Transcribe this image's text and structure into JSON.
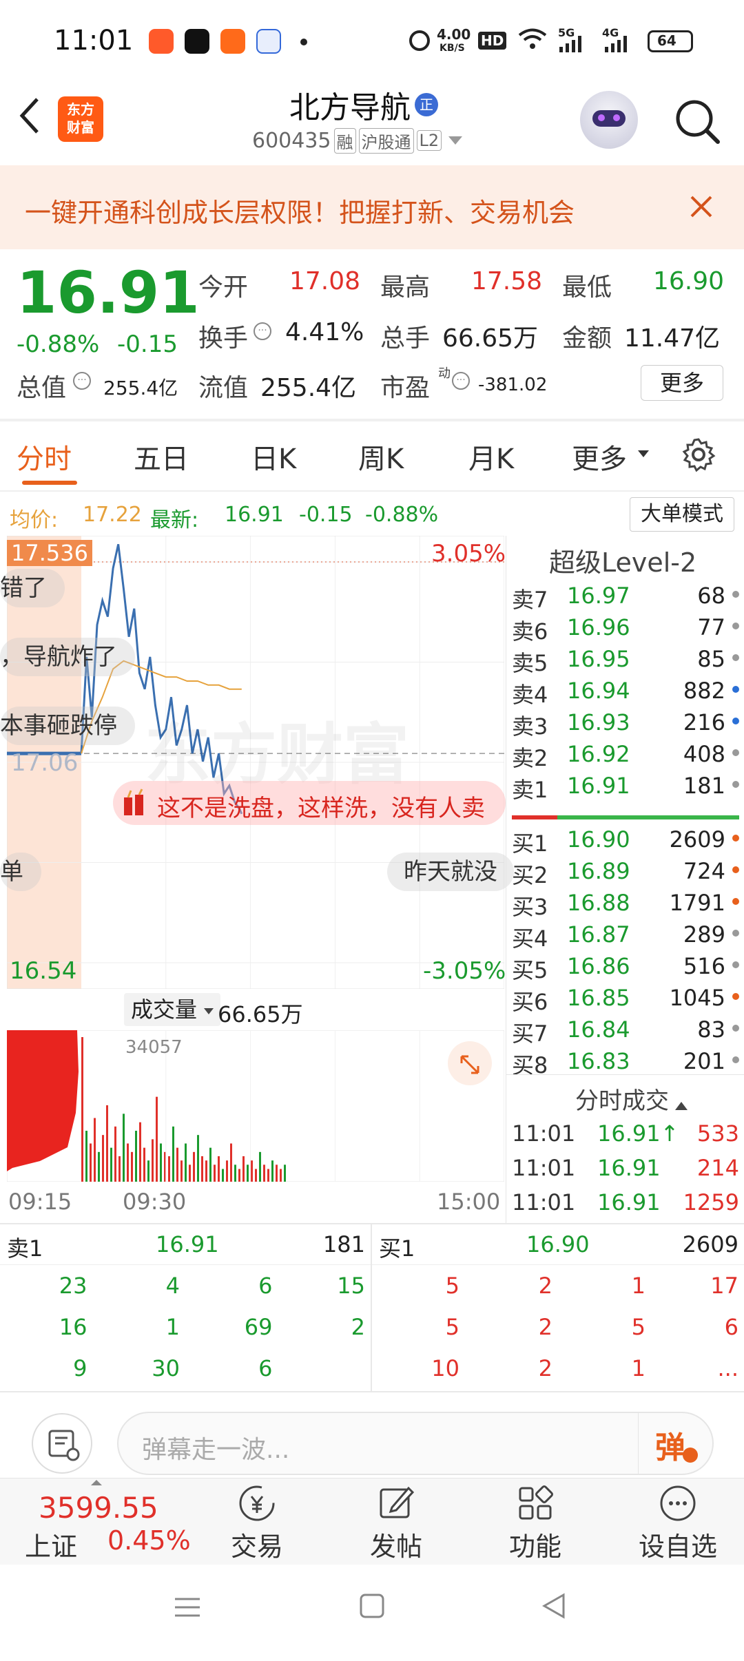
{
  "status_bar": {
    "time": "11:01",
    "net_speed_top": "4.00",
    "net_speed_unit": "KB/S",
    "hd_label": "HD",
    "net_5g": "5G",
    "net_4g": "4G",
    "battery": "64"
  },
  "header": {
    "back_label": "‹",
    "app_logo_line1": "东方",
    "app_logo_line2": "财富",
    "stock_name": "北方导航",
    "zheng_badge": "正",
    "stock_code": "600435",
    "tag_rong": "融",
    "tag_hugutong": "沪股通",
    "tag_l2": "L2"
  },
  "banner": {
    "text": "一键开通科创成长层权限！把握打新、交易机会"
  },
  "quote": {
    "price": "16.91",
    "change_pct": "-0.88%",
    "change": "-0.15",
    "open_label": "今开",
    "open": "17.08",
    "high_label": "最高",
    "high": "17.58",
    "low_label": "最低",
    "low": "16.90",
    "turnover_label": "换手",
    "turnover": "4.41%",
    "volume_label": "总手",
    "volume": "66.65万",
    "amount_label": "金额",
    "amount": "11.47亿",
    "mktcap_label": "总值",
    "mktcap": "255.4亿",
    "float_label": "流值",
    "float_cap": "255.4亿",
    "pe_label": "市盈",
    "pe_sup": "动",
    "pe": "-381.02",
    "more_button": "更多"
  },
  "tabs": [
    "分时",
    "五日",
    "日K",
    "周K",
    "月K",
    "更多"
  ],
  "avg_line": {
    "avg_label": "均价:",
    "avg": "17.22",
    "latest_label": "最新:",
    "latest": "16.91",
    "chg": "-0.15",
    "chg_pct": "-0.88%",
    "big_order_button": "大单模式"
  },
  "chart": {
    "top_price": "17.536",
    "top_pct": "3.05%",
    "bottom_price": "16.54",
    "bottom_pct": "-3.05%",
    "prev_close_partial": "17.06",
    "watermark": "东方财富",
    "danmu": [
      "错了",
      "，导航炸了",
      "本事砸跌停",
      "这不是洗盘，这样洗，没有人卖",
      "单",
      "昨天就没"
    ]
  },
  "chart_data": {
    "type": "line",
    "title": "",
    "series": [
      {
        "name": "最新",
        "x": [
          "09:30",
          "09:33",
          "09:36",
          "09:39",
          "09:42",
          "09:45",
          "09:48",
          "09:51",
          "09:54",
          "09:57",
          "10:00",
          "10:03",
          "10:06",
          "10:09",
          "10:12",
          "10:15",
          "10:18",
          "10:21",
          "10:24",
          "10:27",
          "10:30",
          "10:33",
          "10:36",
          "10:39",
          "10:42",
          "10:45",
          "10:48",
          "10:51",
          "10:54",
          "10:57",
          "11:00",
          "11:01"
        ],
        "values": [
          17.06,
          17.3,
          17.15,
          17.38,
          17.44,
          17.4,
          17.52,
          17.58,
          17.47,
          17.35,
          17.42,
          17.26,
          17.22,
          17.3,
          17.18,
          17.1,
          17.12,
          17.2,
          17.08,
          17.12,
          17.18,
          17.06,
          17.12,
          17.04,
          17.1,
          17.0,
          17.06,
          16.96,
          16.98,
          16.94,
          16.92,
          16.91
        ]
      },
      {
        "name": "均价",
        "x": [
          "09:30",
          "09:36",
          "09:42",
          "09:48",
          "09:54",
          "10:00",
          "10:06",
          "10:12",
          "10:18",
          "10:24",
          "10:30",
          "10:36",
          "10:42",
          "10:48",
          "10:54",
          "11:01"
        ],
        "values": [
          17.06,
          17.14,
          17.2,
          17.27,
          17.29,
          17.28,
          17.27,
          17.26,
          17.25,
          17.25,
          17.24,
          17.24,
          17.23,
          17.23,
          17.22,
          17.22
        ]
      }
    ],
    "ylim": [
      16.54,
      17.536
    ],
    "x_ticks": [
      "09:15",
      "09:30",
      "15:00"
    ],
    "prev_close": 17.06
  },
  "volume": {
    "label": "成交量",
    "total": "66.65万",
    "peak": "34057",
    "bars": [
      34057,
      12000,
      9000,
      15000,
      7000,
      11000,
      18000,
      8000,
      13000,
      6000,
      16000,
      9000,
      7000,
      12000,
      14000,
      8000,
      5000,
      10000,
      20000,
      9000,
      7000,
      6000,
      13000,
      8000,
      5000,
      9000,
      4000,
      7000,
      11000,
      6000,
      5000,
      8000,
      4000,
      6000,
      3000,
      5000,
      9000,
      4000,
      3000,
      6000,
      4000,
      5000,
      3000,
      7000,
      4000,
      3000,
      5000,
      4000,
      3000,
      4000
    ]
  },
  "time_axis": [
    "09:15",
    "09:30",
    "15:00"
  ],
  "level2": {
    "title": "超级Level-2",
    "sells": [
      {
        "label": "卖7",
        "price": "16.97",
        "vol": "68",
        "dot": "#999999"
      },
      {
        "label": "卖6",
        "price": "16.96",
        "vol": "77",
        "dot": "#999999"
      },
      {
        "label": "卖5",
        "price": "16.95",
        "vol": "85",
        "dot": "#999999"
      },
      {
        "label": "卖4",
        "price": "16.94",
        "vol": "882",
        "dot": "#2a6fd6"
      },
      {
        "label": "卖3",
        "price": "16.93",
        "vol": "216",
        "dot": "#2a6fd6"
      },
      {
        "label": "卖2",
        "price": "16.92",
        "vol": "408",
        "dot": "#999999"
      },
      {
        "label": "卖1",
        "price": "16.91",
        "vol": "181",
        "dot": "#999999"
      }
    ],
    "buys": [
      {
        "label": "买1",
        "price": "16.90",
        "vol": "2609",
        "dot": "#e8601c"
      },
      {
        "label": "买2",
        "price": "16.89",
        "vol": "724",
        "dot": "#e8601c"
      },
      {
        "label": "买3",
        "price": "16.88",
        "vol": "1791",
        "dot": "#e8601c"
      },
      {
        "label": "买4",
        "price": "16.87",
        "vol": "289",
        "dot": "#999999"
      },
      {
        "label": "买5",
        "price": "16.86",
        "vol": "516",
        "dot": "#999999"
      },
      {
        "label": "买6",
        "price": "16.85",
        "vol": "1045",
        "dot": "#e8601c"
      },
      {
        "label": "买7",
        "price": "16.84",
        "vol": "83",
        "dot": "#999999"
      },
      {
        "label": "买8",
        "price": "16.83",
        "vol": "201",
        "dot": "#999999"
      }
    ],
    "trades_title": "分时成交",
    "trades": [
      {
        "time": "11:01",
        "price": "16.91",
        "arrow": "↑",
        "vol": "533"
      },
      {
        "time": "11:01",
        "price": "16.91",
        "arrow": "",
        "vol": "214"
      },
      {
        "time": "11:01",
        "price": "16.91",
        "arrow": "",
        "vol": "1259"
      }
    ]
  },
  "queue": {
    "sell_label": "卖1",
    "sell_price": "16.91",
    "sell_vol": "181",
    "buy_label": "买1",
    "buy_price": "16.90",
    "buy_vol": "2609",
    "sell_rows": [
      [
        "23",
        "4",
        "6",
        "15"
      ],
      [
        "16",
        "1",
        "69",
        "2"
      ],
      [
        "9",
        "30",
        "6",
        ""
      ]
    ],
    "buy_rows": [
      [
        "5",
        "2",
        "1",
        "17"
      ],
      [
        "5",
        "2",
        "5",
        "6"
      ],
      [
        "10",
        "2",
        "1",
        "..."
      ]
    ]
  },
  "comment": {
    "placeholder": "弹幕走一波...",
    "send_label": "弹"
  },
  "bottom_nav": {
    "index_value": "3599.55",
    "index_name": "上证",
    "index_pct": "0.45%",
    "items": [
      "交易",
      "发帖",
      "功能",
      "设自选"
    ]
  }
}
